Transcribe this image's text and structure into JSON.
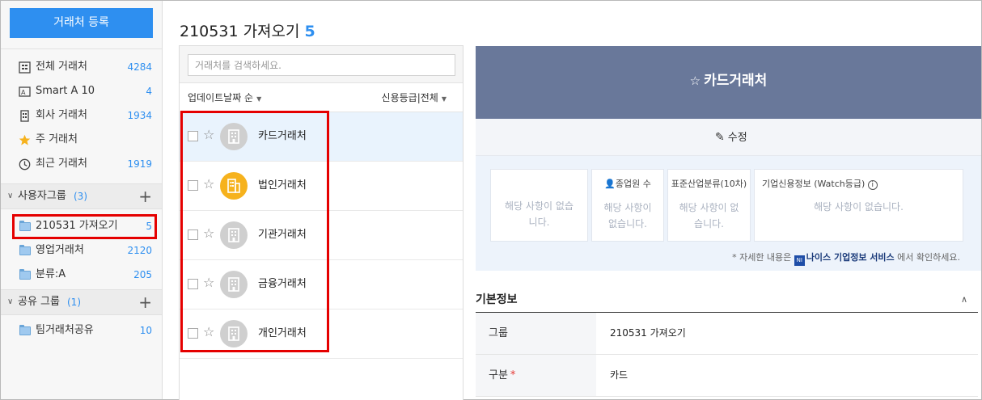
{
  "sidebar": {
    "register_button": "거래처 등록",
    "items": [
      {
        "label": "전체 거래처",
        "count": "4284",
        "icon": "building-list-icon"
      },
      {
        "label": "Smart A 10",
        "count": "4",
        "icon": "smart-a-icon"
      },
      {
        "label": "회사 거래처",
        "count": "1934",
        "icon": "company-building-icon"
      },
      {
        "label": "주 거래처",
        "count": "",
        "icon": "star-icon"
      },
      {
        "label": "최근 거래처",
        "count": "1919",
        "icon": "clock-icon"
      }
    ],
    "user_group": {
      "label": "사용자그룹",
      "count": "(3)",
      "folders": [
        {
          "label": "210531 가져오기",
          "count": "5"
        },
        {
          "label": "영업거래처",
          "count": "2120"
        },
        {
          "label": "분류:A",
          "count": "205"
        }
      ]
    },
    "shared_group": {
      "label": "공유 그룹",
      "count": "(1)",
      "folders": [
        {
          "label": "팀거래처공유",
          "count": "10"
        }
      ]
    }
  },
  "list": {
    "title": "210531 가져오기",
    "title_count": "5",
    "search_placeholder": "거래처를 검색하세요.",
    "sort_label": "업데이트날짜 순",
    "filter_label": "신용등급|전체",
    "rows": [
      {
        "name": "카드거래처",
        "avatar": "gray"
      },
      {
        "name": "법인거래처",
        "avatar": "gold"
      },
      {
        "name": "기관거래처",
        "avatar": "gray"
      },
      {
        "name": "금융거래처",
        "avatar": "gray"
      },
      {
        "name": "개인거래처",
        "avatar": "gray"
      }
    ]
  },
  "detail": {
    "star": "☆",
    "title": "카드거래처",
    "edit_label": "수정",
    "cards": [
      {
        "title": "",
        "value_line1": "해당 사항이 없습",
        "value_line2": "니다."
      },
      {
        "title": "종업원 수",
        "value_line1": "해당 사항이",
        "value_line2": "없습니다."
      },
      {
        "title": "표준산업분류(10차)",
        "value_line1": "해당 사항이 없",
        "value_line2": "습니다."
      },
      {
        "title": "기업신용정보 (Watch등급)",
        "value_line1": "해당 사항이 없습니다.",
        "value_line2": ""
      }
    ],
    "note_prefix": "* 자세한 내용은",
    "note_link": "나이스 기업정보 서비스",
    "note_suffix": "에서 확인하세요.",
    "basic_title": "기본정보",
    "fields": [
      {
        "key": "그룹",
        "value": "210531 가져오기",
        "required": false
      },
      {
        "key": "구분",
        "value": "카드",
        "required": true
      }
    ]
  }
}
